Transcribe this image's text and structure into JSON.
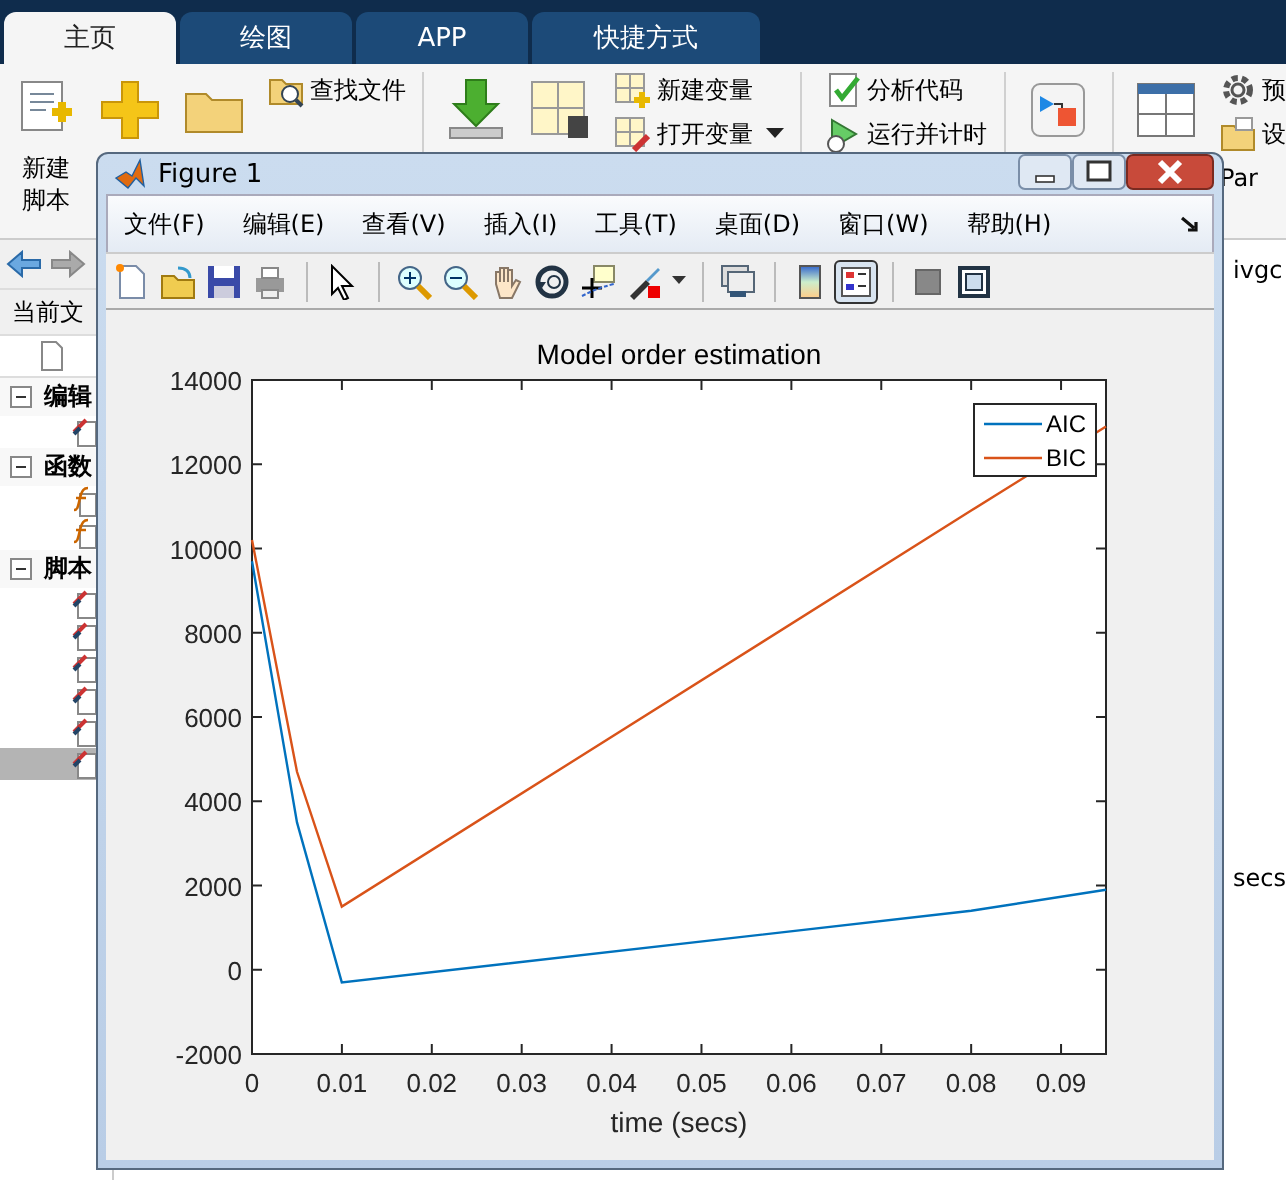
{
  "app": {
    "tabs": [
      {
        "label": "主页",
        "selected": true
      },
      {
        "label": "绘图",
        "selected": false
      },
      {
        "label": "APP",
        "selected": false
      },
      {
        "label": "快捷方式",
        "selected": false
      }
    ],
    "ribbon": [
      {
        "items": [
          {
            "kind": "large",
            "label": "新建脚本"
          },
          {
            "kind": "large"
          },
          {
            "kind": "large"
          },
          {
            "kind": "stack",
            "entries": [
              {
                "label": "查找文件",
                "dropdown": false
              }
            ]
          }
        ]
      },
      {
        "items": [
          {
            "kind": "large"
          },
          {
            "kind": "large"
          },
          {
            "kind": "stack",
            "entries": [
              {
                "label": "新建变量",
                "dropdown": false
              },
              {
                "label": "打开变量",
                "dropdown": true
              }
            ]
          }
        ]
      },
      {
        "items": [
          {
            "kind": "stack",
            "entries": [
              {
                "label": "分析代码",
                "dropdown": false
              },
              {
                "label": "运行并计时",
                "dropdown": false
              }
            ]
          }
        ]
      },
      {
        "items": [
          {
            "kind": "large"
          }
        ]
      },
      {
        "items": [
          {
            "kind": "large"
          },
          {
            "kind": "stack",
            "entries": [
              {
                "label": "预",
                "dropdown": false
              },
              {
                "label": "设",
                "dropdown": false
              },
              {
                "label": "Par",
                "dropdown": false
              }
            ]
          }
        ]
      }
    ],
    "current_folder": "当前文",
    "tree": [
      {
        "label": "编辑",
        "expanded": true,
        "children": [
          {
            "selected": false
          }
        ]
      },
      {
        "label": "函数",
        "expanded": true,
        "children": [
          {
            "selected": false
          },
          {
            "selected": false
          }
        ]
      },
      {
        "label": "脚本",
        "expanded": true,
        "children": [
          {
            "selected": false
          },
          {
            "selected": false
          },
          {
            "selected": false
          },
          {
            "selected": false
          },
          {
            "selected": false
          },
          {
            "selected": true
          }
        ]
      }
    ],
    "right_texts": [
      "ivgc",
      "secs"
    ]
  },
  "figure": {
    "title": "Figure 1",
    "menus": [
      "文件(F)",
      "编辑(E)",
      "查看(V)",
      "插入(I)",
      "工具(T)",
      "桌面(D)",
      "窗口(W)",
      "帮助(H)"
    ],
    "toolbar": [
      {
        "pressed": false
      },
      {
        "pressed": false
      },
      {
        "pressed": false
      },
      {
        "pressed": false
      },
      {
        "pressed": false
      },
      {
        "pressed": false
      },
      {
        "pressed": false
      },
      {
        "pressed": false
      },
      {
        "pressed": false
      },
      {
        "pressed": false
      },
      {
        "pressed": false
      },
      {
        "pressed": false
      },
      {
        "pressed": false
      },
      {
        "pressed": true
      },
      {
        "pressed": false
      },
      {
        "pressed": false
      }
    ],
    "chart_data": {
      "type": "line",
      "title": "Model order estimation",
      "xlabel": "time (secs)",
      "x": [
        0,
        0.005,
        0.01,
        0.08,
        0.095
      ],
      "series": [
        {
          "name": "AIC",
          "color": "#0072bd",
          "values": [
            9700,
            3500,
            -300,
            1400,
            1900
          ]
        },
        {
          "name": "BIC",
          "color": "#d95319",
          "values": [
            10200,
            4700,
            1500,
            10900,
            12900
          ]
        }
      ],
      "legend": "upper right",
      "xlim": [
        0,
        0.095
      ],
      "ylim": [
        -2000,
        14000
      ],
      "xticks": [
        0,
        0.01,
        0.02,
        0.03,
        0.04,
        0.05,
        0.06,
        0.07,
        0.08,
        0.09
      ],
      "yticks": [
        -2000,
        0,
        2000,
        4000,
        6000,
        8000,
        10000,
        12000,
        14000
      ]
    }
  }
}
